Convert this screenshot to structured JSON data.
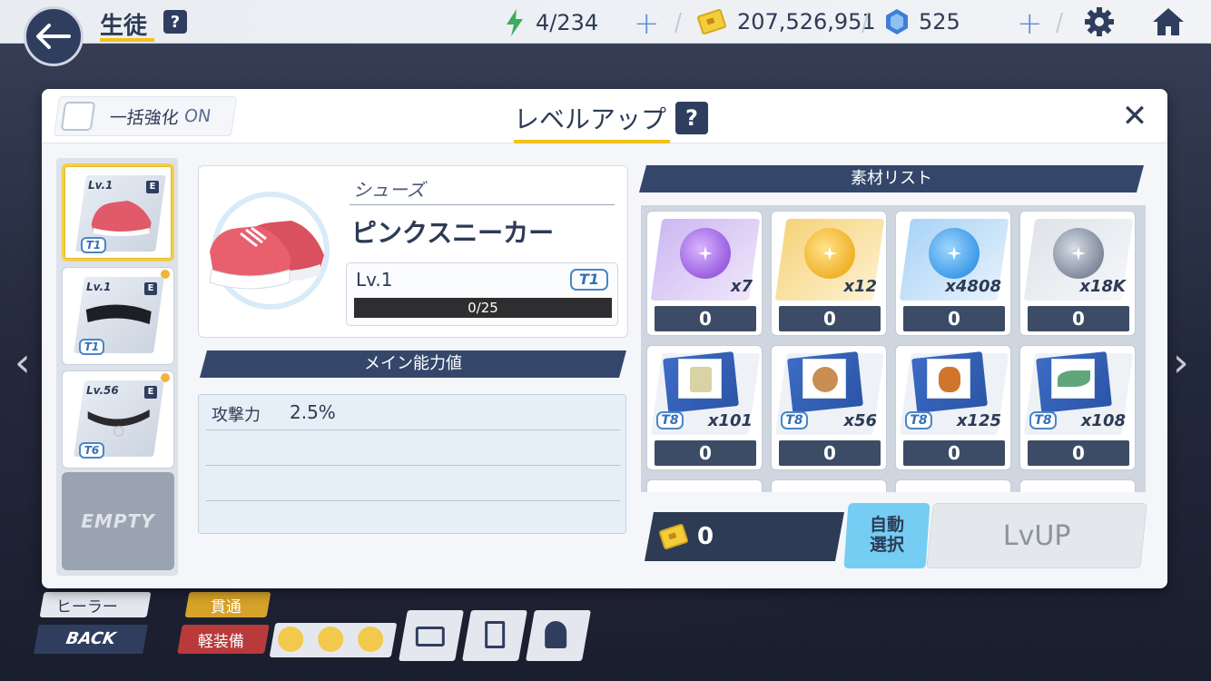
{
  "header": {
    "title": "生徒",
    "stamina": "4/234",
    "credits": "207,526,951",
    "gems": "525"
  },
  "modal": {
    "bulk_label": "一括強化",
    "bulk_state": "ON",
    "title": "レベルアップ",
    "help": "?",
    "close": "✕"
  },
  "equip_slots": [
    {
      "level": "Lv.1",
      "grade": "E",
      "tier": "T1"
    },
    {
      "level": "Lv.1",
      "grade": "E",
      "tier": "T1"
    },
    {
      "level": "Lv.56",
      "grade": "E",
      "tier": "T6"
    }
  ],
  "empty_slot": "EMPTY",
  "item": {
    "category": "シューズ",
    "name": "ピンクスニーカー",
    "level": "Lv.1",
    "tier": "T1",
    "exp": "0/25",
    "exp_fraction": 0
  },
  "main_stat": {
    "header": "メイン能力値",
    "rows": [
      {
        "name": "攻撃力",
        "value": "2.5%"
      }
    ]
  },
  "materials": {
    "header": "素材リスト",
    "items": [
      {
        "kind": "purple-orb-icon",
        "qty": "x7",
        "selected": "0",
        "color": "#9b5fe0"
      },
      {
        "kind": "gold-orb-icon",
        "qty": "x12",
        "selected": "0",
        "color": "#f0b22a"
      },
      {
        "kind": "blue-orb-icon",
        "qty": "x4808",
        "selected": "0",
        "color": "#3f9be8"
      },
      {
        "kind": "silver-orb-icon",
        "qty": "x18K",
        "selected": "0",
        "color": "#8d97a6"
      },
      {
        "kind": "glove-blueprint-icon",
        "tier": "T8",
        "qty": "x101",
        "selected": "0"
      },
      {
        "kind": "coin-blueprint-icon",
        "tier": "T8",
        "qty": "x56",
        "selected": "0"
      },
      {
        "kind": "amulet-blueprint-icon",
        "tier": "T8",
        "qty": "x125",
        "selected": "0"
      },
      {
        "kind": "leaf-blueprint-icon",
        "tier": "T8",
        "qty": "x108",
        "selected": "0"
      }
    ]
  },
  "footer": {
    "cost": "0",
    "auto_select": "自動\n選択",
    "lvup": "LvUP"
  },
  "toolbar": {
    "role": "ヒーラー",
    "attack_type": "貫通",
    "armor_type": "軽装備",
    "back": "BACK"
  }
}
